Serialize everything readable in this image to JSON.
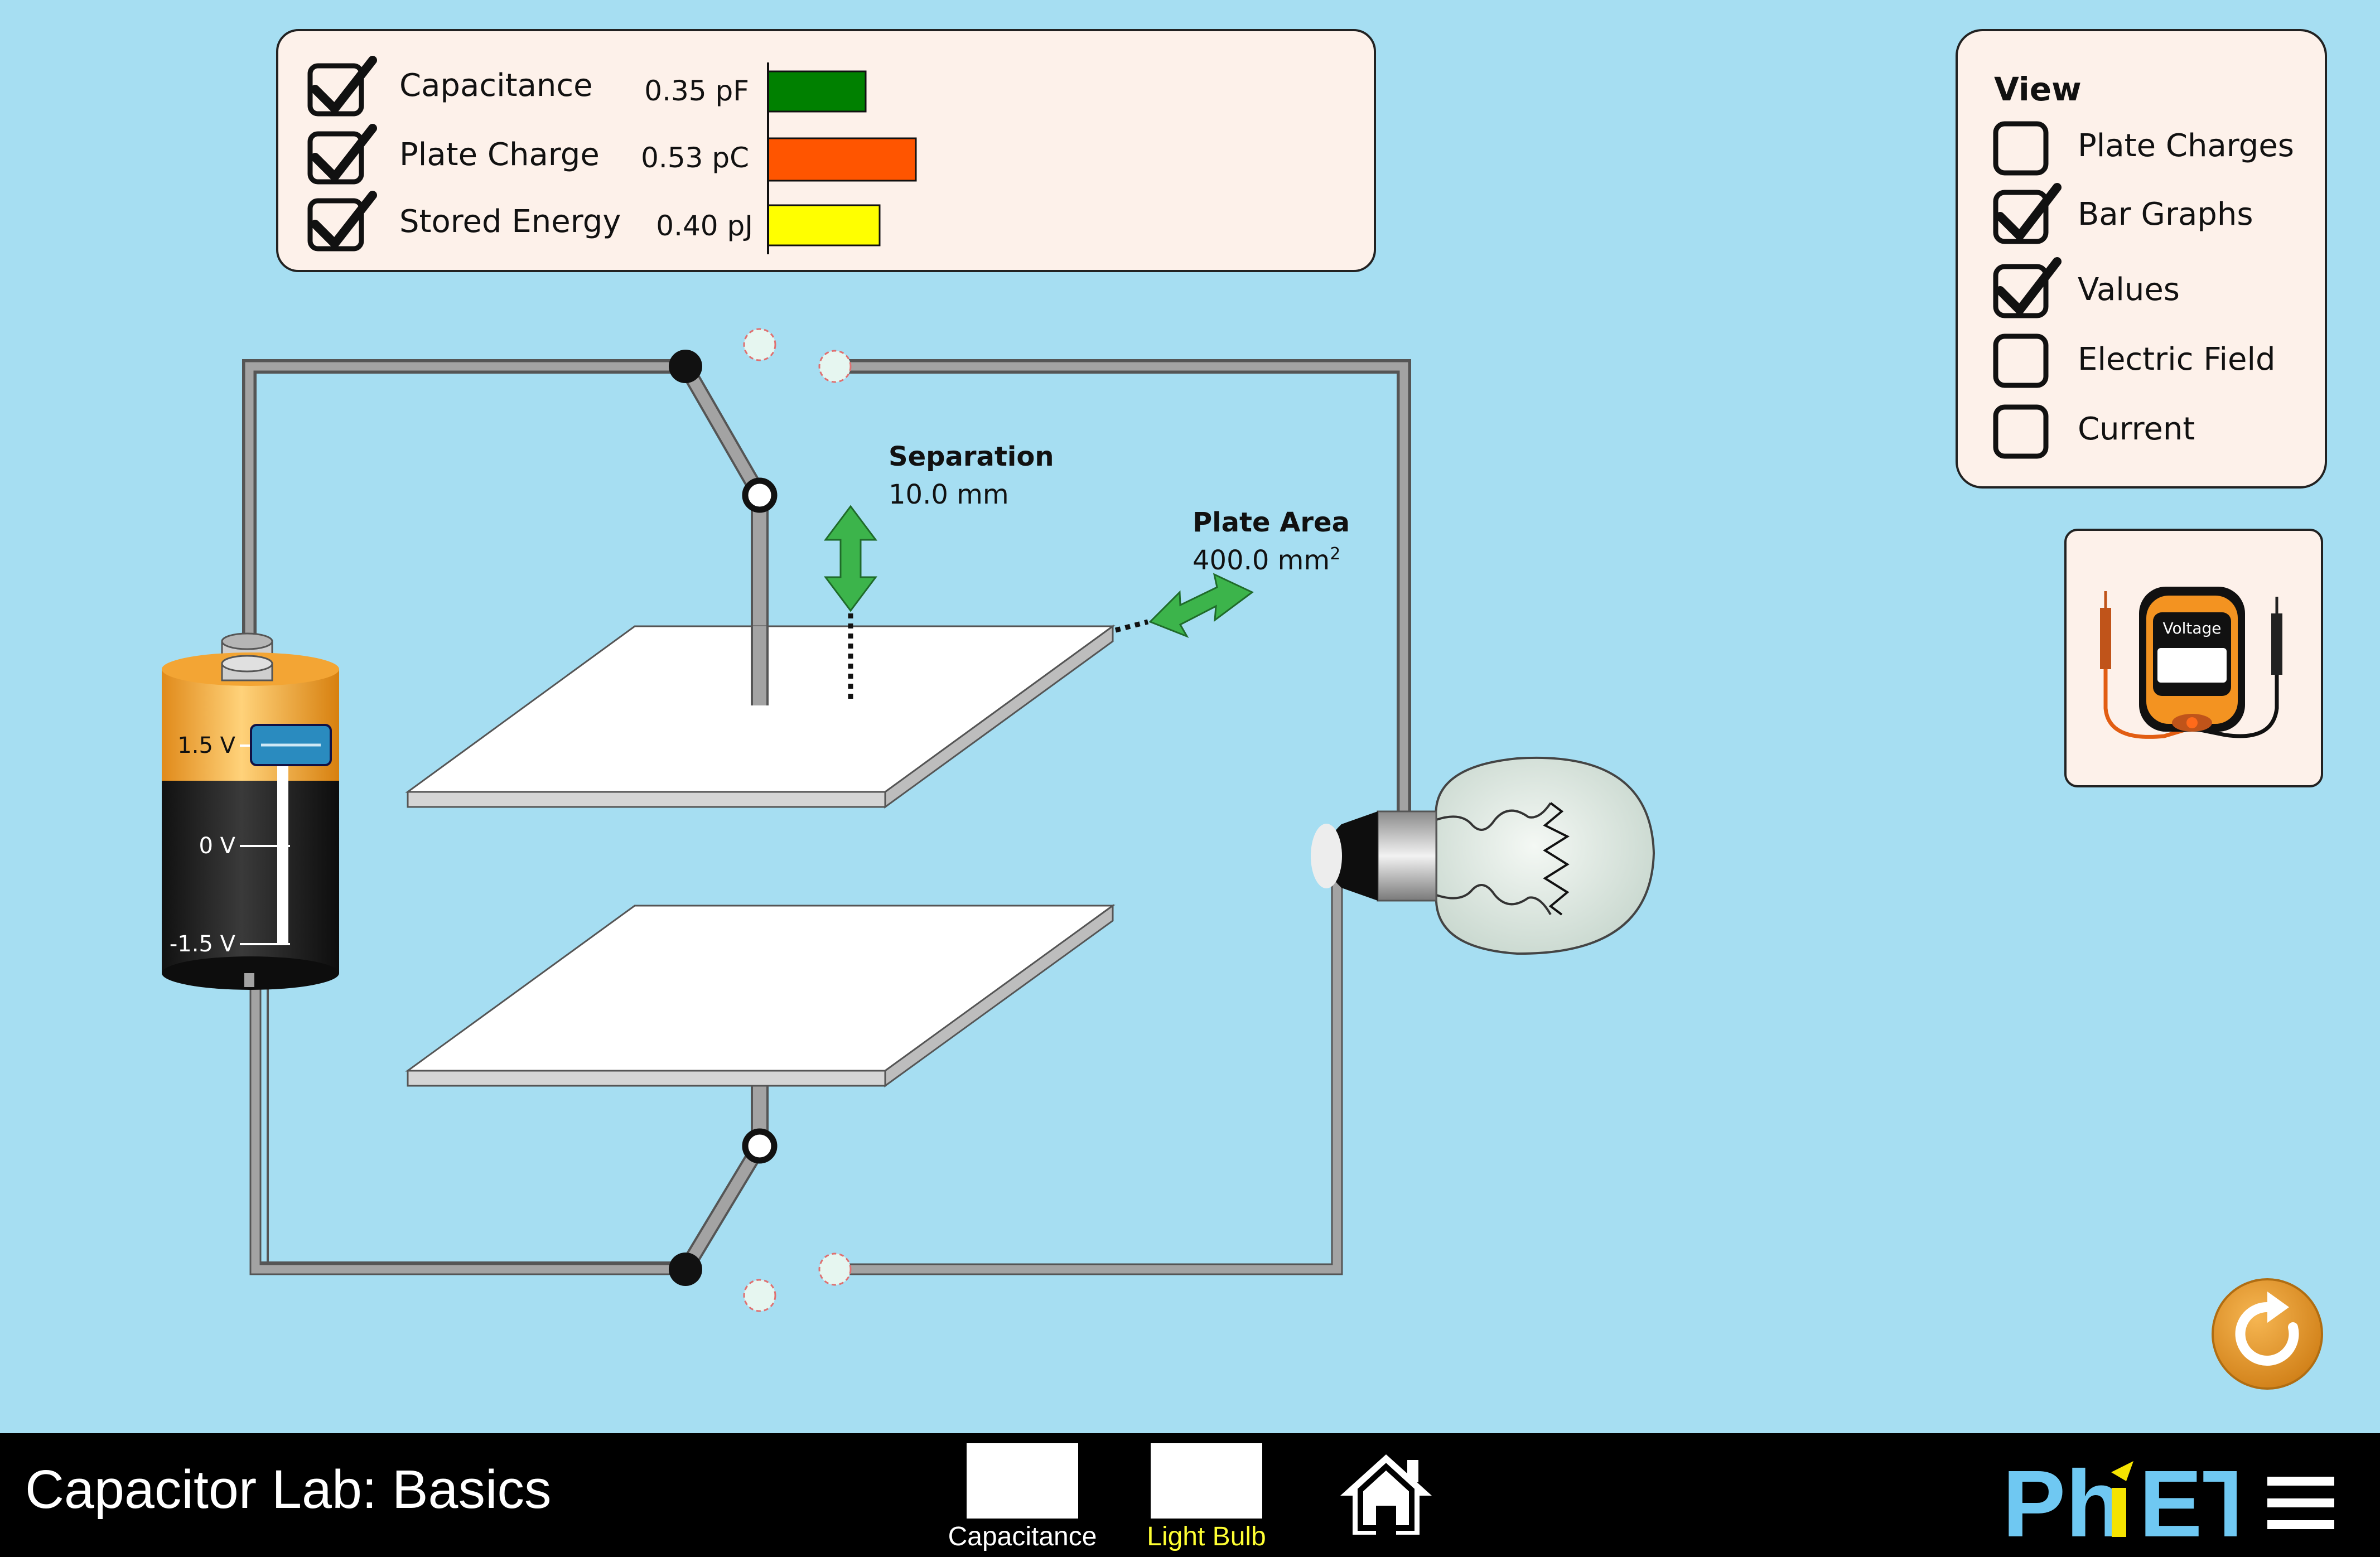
{
  "meters_panel": {
    "rows": [
      {
        "label": "Capacitance",
        "value": "0.35 pF",
        "checked": true,
        "bar_fraction": 0.35,
        "bar_color": "#008000"
      },
      {
        "label": "Plate Charge",
        "value": "0.53 pC",
        "checked": true,
        "bar_fraction": 0.53,
        "bar_color": "#ff5500"
      },
      {
        "label": "Stored Energy",
        "value": "0.40 pJ",
        "checked": true,
        "bar_fraction": 0.4,
        "bar_color": "#ffff00"
      }
    ]
  },
  "view_panel": {
    "title": "View",
    "options": [
      {
        "label": "Plate Charges",
        "checked": false
      },
      {
        "label": "Bar Graphs",
        "checked": true
      },
      {
        "label": "Values",
        "checked": true
      },
      {
        "label": "Electric Field",
        "checked": false
      },
      {
        "label": "Current",
        "checked": false
      }
    ]
  },
  "voltmeter": {
    "label": "Voltage"
  },
  "capacitor": {
    "separation_label": "Separation",
    "separation_value": "10.0 mm",
    "area_label": "Plate Area",
    "area_value": "400.0 mm",
    "area_unit_sup": "2"
  },
  "battery": {
    "labels": [
      "1.5 V",
      "0 V",
      "-1.5 V"
    ],
    "voltage_fraction": 1.0
  },
  "navbar": {
    "title": "Capacitor Lab: Basics",
    "screens": [
      {
        "label": "Capacitance",
        "selected": false,
        "label_color": "#ffffff"
      },
      {
        "label": "Light Bulb",
        "selected": true,
        "label_color": "#ffff33"
      }
    ],
    "logo": "PhET"
  },
  "colors": {
    "background": "#a6def2",
    "panel_fill": "#fdf1ea",
    "wire": "#a3a3a3",
    "arrow": "#3cb44b",
    "reset": "#e0962c"
  }
}
